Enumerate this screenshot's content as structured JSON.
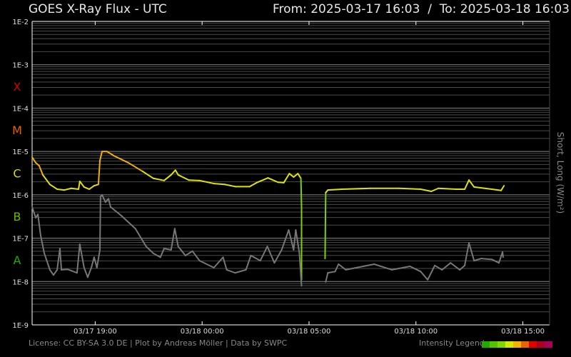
{
  "header": {
    "title": "GOES X-Ray Flux - UTC",
    "range": "From: 2025-03-17 16:03  /  To: 2025-03-18 16:03"
  },
  "footer": {
    "credits": "License: CC BY-SA 3.0 DE | Plot by Andreas Möller | Data by SWPC",
    "legend_label": "Intensity Legend"
  },
  "legend_colors": [
    "#22aa00",
    "#55c400",
    "#80d800",
    "#d4e800",
    "#f2b400",
    "#ea6400",
    "#e00000",
    "#b00020",
    "#a8005a"
  ],
  "chart_data": {
    "type": "line",
    "title": "GOES X-Ray Flux - UTC",
    "ylabel": "Short, Long (W/m²)",
    "yscale": "log",
    "ylim_exp": [
      -9,
      -2
    ],
    "ytick_labels": [
      "1E-9",
      "1E-8",
      "1E-7",
      "1E-6",
      "1E-5",
      "1E-4",
      "1E-3",
      "1E-2"
    ],
    "flare_classes": [
      {
        "label": "A",
        "exp": -8,
        "color": "#22aa00"
      },
      {
        "label": "B",
        "exp": -7,
        "color": "#66bb00"
      },
      {
        "label": "C",
        "exp": -6,
        "color": "#d8d800"
      },
      {
        "label": "M",
        "exp": -5,
        "color": "#e86000"
      },
      {
        "label": "X",
        "exp": -4,
        "color": "#cc0000"
      }
    ],
    "x_unit": "hours since 2025-03-17 16:03 UTC",
    "xlim": [
      0,
      24.2
    ],
    "xticks": [
      {
        "h": 2.95,
        "label": "03/17 19:00"
      },
      {
        "h": 7.95,
        "label": "03/18 00:00"
      },
      {
        "h": 12.95,
        "label": "03/18 05:00"
      },
      {
        "h": 17.95,
        "label": "03/18 10:00"
      },
      {
        "h": 22.95,
        "label": "03/18 15:00"
      }
    ],
    "grid": true,
    "series": [
      {
        "name": "Long",
        "segments": [
          [
            [
              0,
              -5.13
            ],
            [
              0.17,
              -5.26
            ],
            [
              0.33,
              -5.33
            ],
            [
              0.5,
              -5.54
            ],
            [
              0.83,
              -5.76
            ],
            [
              1.17,
              -5.87
            ],
            [
              1.5,
              -5.89
            ],
            [
              1.83,
              -5.85
            ],
            [
              2.17,
              -5.87
            ],
            [
              2.23,
              -5.69
            ],
            [
              2.43,
              -5.82
            ],
            [
              2.67,
              -5.87
            ],
            [
              2.9,
              -5.79
            ],
            [
              3.1,
              -5.76
            ],
            [
              3.17,
              -5.21
            ],
            [
              3.27,
              -5.0
            ],
            [
              3.5,
              -5.0
            ],
            [
              3.83,
              -5.1
            ],
            [
              4.5,
              -5.26
            ],
            [
              5.17,
              -5.46
            ],
            [
              5.67,
              -5.62
            ],
            [
              6.17,
              -5.67
            ],
            [
              6.5,
              -5.54
            ],
            [
              6.7,
              -5.43
            ],
            [
              6.83,
              -5.54
            ],
            [
              7.33,
              -5.66
            ],
            [
              7.83,
              -5.67
            ],
            [
              8.5,
              -5.74
            ],
            [
              9,
              -5.76
            ],
            [
              9.5,
              -5.81
            ],
            [
              10.17,
              -5.81
            ],
            [
              10.5,
              -5.72
            ],
            [
              11.03,
              -5.61
            ],
            [
              11.5,
              -5.71
            ],
            [
              11.77,
              -5.72
            ],
            [
              12.03,
              -5.51
            ],
            [
              12.23,
              -5.59
            ],
            [
              12.43,
              -5.51
            ],
            [
              12.57,
              -5.62
            ],
            [
              12.6,
              -6.28
            ],
            [
              12.6,
              -7.96
            ]
          ],
          [
            [
              13.7,
              -7.47
            ],
            [
              13.73,
              -5.95
            ],
            [
              13.83,
              -5.89
            ],
            [
              14.5,
              -5.87
            ],
            [
              15.83,
              -5.85
            ],
            [
              17.17,
              -5.85
            ],
            [
              18.17,
              -5.87
            ],
            [
              18.67,
              -5.92
            ],
            [
              19,
              -5.85
            ],
            [
              19.83,
              -5.87
            ],
            [
              20.23,
              -5.87
            ],
            [
              20.43,
              -5.66
            ],
            [
              20.67,
              -5.82
            ],
            [
              21.5,
              -5.87
            ],
            [
              21.93,
              -5.9
            ],
            [
              22.07,
              -5.79
            ]
          ]
        ]
      },
      {
        "name": "Short",
        "color": "#777777",
        "segments": [
          [
            [
              0,
              -6.28
            ],
            [
              0.17,
              -6.53
            ],
            [
              0.27,
              -6.45
            ],
            [
              0.4,
              -6.94
            ],
            [
              0.57,
              -7.35
            ],
            [
              0.83,
              -7.73
            ],
            [
              1,
              -7.85
            ],
            [
              1.17,
              -7.73
            ],
            [
              1.3,
              -7.24
            ],
            [
              1.37,
              -7.73
            ],
            [
              1.67,
              -7.72
            ],
            [
              2.1,
              -7.8
            ],
            [
              2.23,
              -7.14
            ],
            [
              2.43,
              -7.68
            ],
            [
              2.6,
              -7.9
            ],
            [
              2.77,
              -7.68
            ],
            [
              2.9,
              -7.44
            ],
            [
              3.03,
              -7.68
            ],
            [
              3.17,
              -7.27
            ],
            [
              3.2,
              -6.04
            ],
            [
              3.27,
              -6.0
            ],
            [
              3.43,
              -6.17
            ],
            [
              3.57,
              -6.09
            ],
            [
              3.67,
              -6.28
            ],
            [
              4.17,
              -6.48
            ],
            [
              4.83,
              -6.78
            ],
            [
              5.33,
              -7.19
            ],
            [
              5.67,
              -7.35
            ],
            [
              6,
              -7.44
            ],
            [
              6.17,
              -7.24
            ],
            [
              6.5,
              -7.27
            ],
            [
              6.67,
              -6.78
            ],
            [
              6.83,
              -7.19
            ],
            [
              7.17,
              -7.4
            ],
            [
              7.5,
              -7.3
            ],
            [
              7.83,
              -7.52
            ],
            [
              8.5,
              -7.68
            ],
            [
              8.93,
              -7.44
            ],
            [
              9.1,
              -7.73
            ],
            [
              9.5,
              -7.8
            ],
            [
              10,
              -7.73
            ],
            [
              10.23,
              -7.4
            ],
            [
              10.67,
              -7.52
            ],
            [
              11,
              -7.19
            ],
            [
              11.33,
              -7.57
            ],
            [
              11.67,
              -7.27
            ],
            [
              12,
              -6.81
            ],
            [
              12.23,
              -7.27
            ],
            [
              12.33,
              -6.81
            ],
            [
              12.5,
              -7.35
            ],
            [
              12.6,
              -8.1
            ]
          ],
          [
            [
              13.73,
              -8.01
            ],
            [
              13.83,
              -7.8
            ],
            [
              14.17,
              -7.77
            ],
            [
              14.33,
              -7.6
            ],
            [
              14.67,
              -7.73
            ],
            [
              15.17,
              -7.68
            ],
            [
              16,
              -7.6
            ],
            [
              16.83,
              -7.73
            ],
            [
              17.67,
              -7.65
            ],
            [
              18.17,
              -7.77
            ],
            [
              18.5,
              -7.96
            ],
            [
              18.83,
              -7.63
            ],
            [
              19.17,
              -7.73
            ],
            [
              19.57,
              -7.57
            ],
            [
              20,
              -7.73
            ],
            [
              20.23,
              -7.63
            ],
            [
              20.43,
              -7.11
            ],
            [
              20.67,
              -7.52
            ],
            [
              21,
              -7.47
            ],
            [
              21.5,
              -7.49
            ],
            [
              21.83,
              -7.57
            ],
            [
              22,
              -7.32
            ],
            [
              22.03,
              -7.44
            ]
          ]
        ]
      }
    ]
  }
}
